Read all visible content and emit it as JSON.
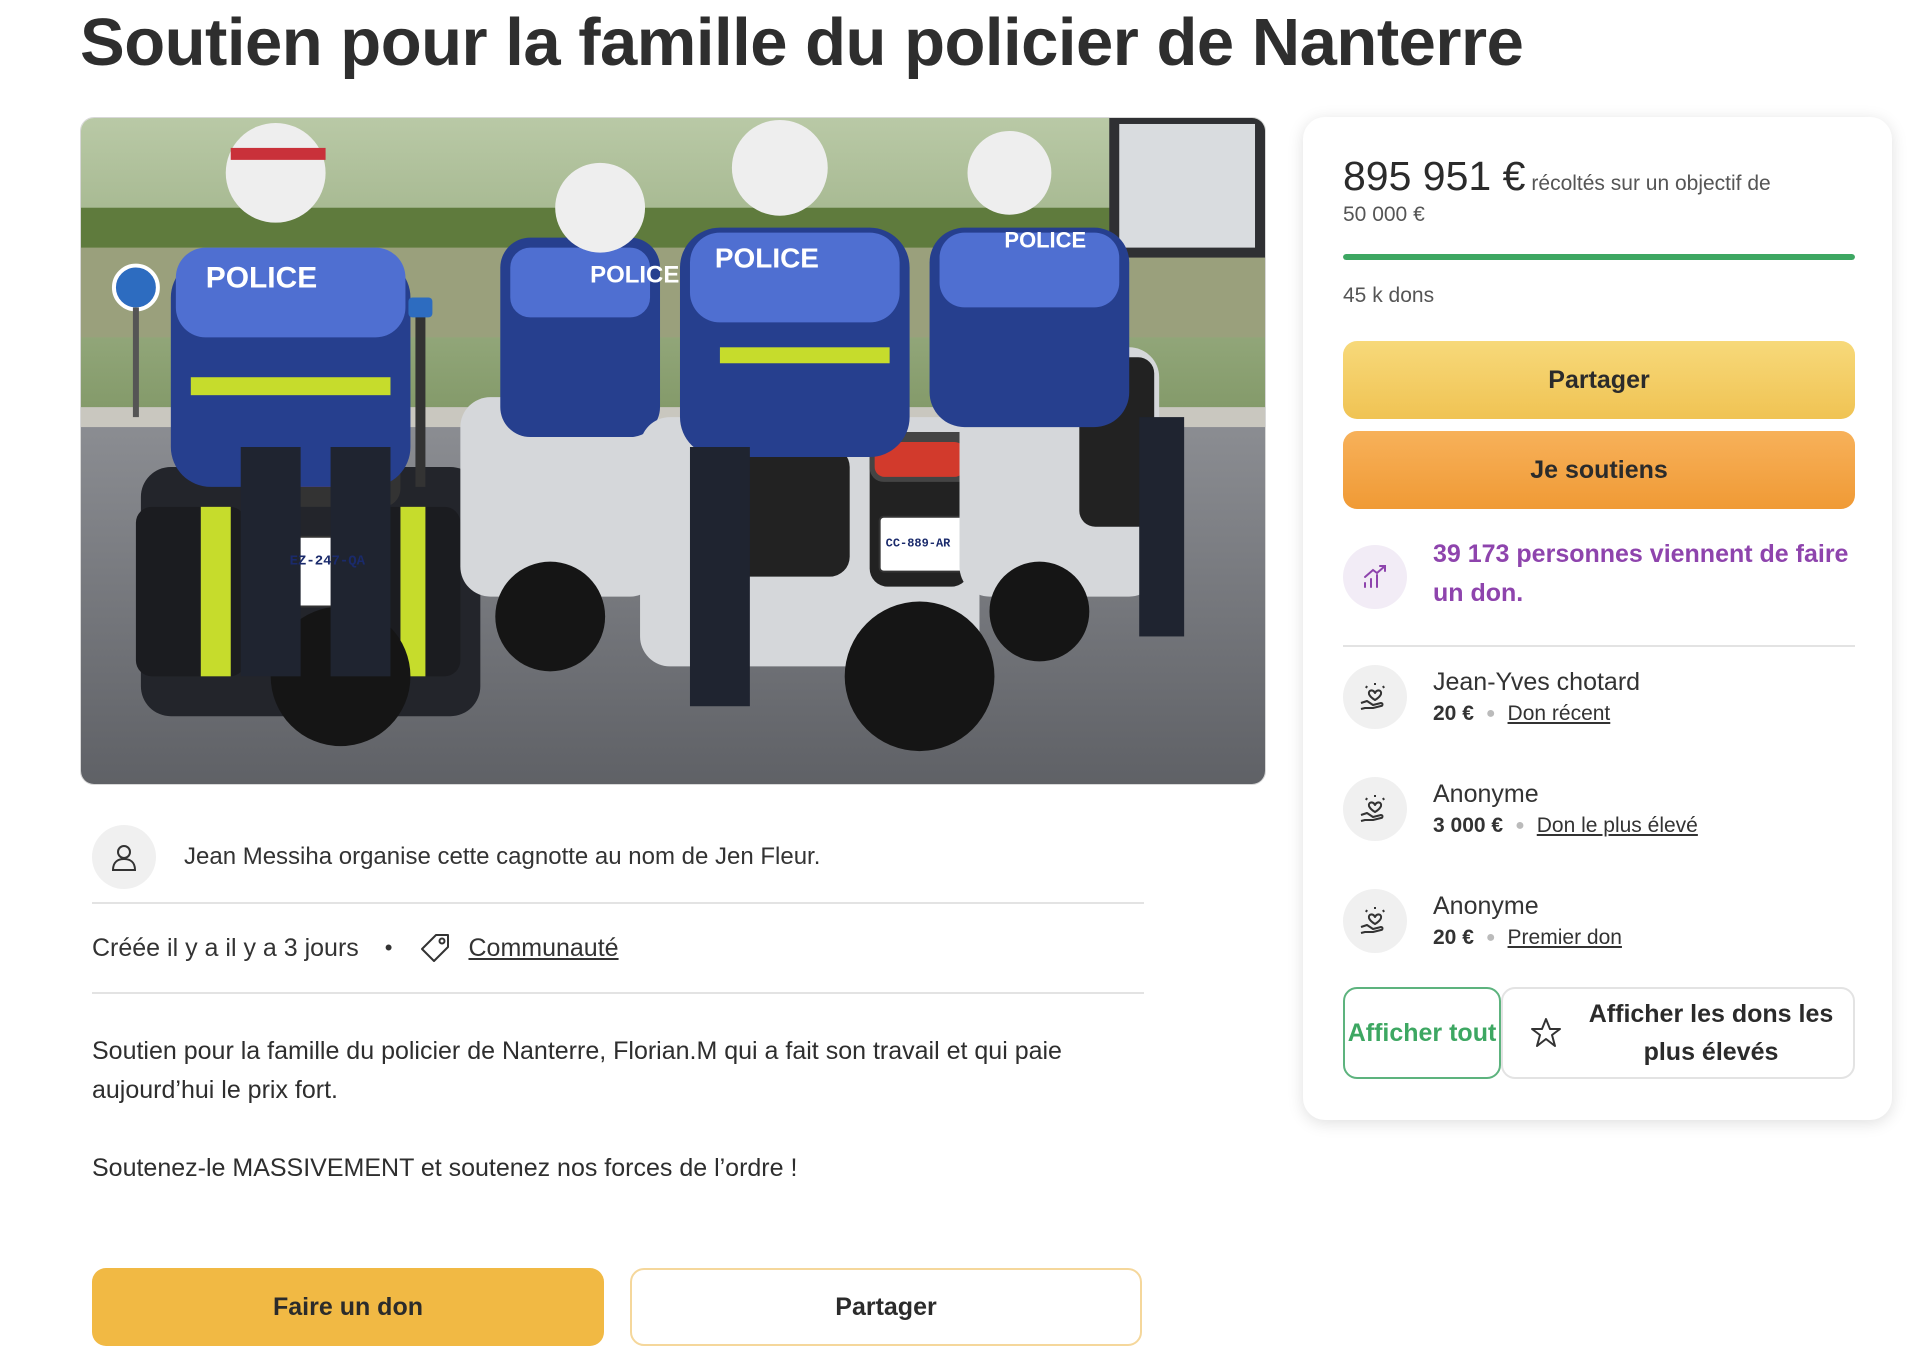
{
  "title": "Soutien pour la famille du policier de Nanterre",
  "hero": {
    "icon": "police-motorcycles-photo",
    "sign_texts": [
      "POLICE",
      "POLICE",
      "POLICE",
      "POLICE"
    ],
    "plates": [
      "EZ-247-QA",
      "CC-889-AR"
    ]
  },
  "organizer": {
    "icon": "user-icon",
    "text": "Jean Messiha organise cette cagnotte au nom de Jen Fleur."
  },
  "meta": {
    "created": "Créée il y a il y a 3 jours",
    "separator": "•",
    "tag_icon": "tag-icon",
    "category": "Communauté"
  },
  "description": {
    "paragraph1": "Soutien pour la famille du policier de Nanterre, Florian.M qui a fait son travail et qui paie aujourd’hui le prix fort.",
    "paragraph2": "Soutenez-le MASSIVEMENT et soutenez nos forces de l’ordre !"
  },
  "bottom_buttons": {
    "donate": "Faire un don",
    "share": "Partager"
  },
  "card": {
    "amount_raised": "895 951 €",
    "amount_text": "récoltés sur un objectif de",
    "goal": "50 000 €",
    "progress_fraction": 1.0,
    "donations_count": "45 k dons",
    "share_label": "Partager",
    "support_label": "Je soutiens",
    "trend_icon": "trending-up-icon",
    "trend_text": "39 173 personnes viennent de faire un don.",
    "donors": [
      {
        "name": "Jean-Yves chotard",
        "amount": "20 €",
        "label": "Don récent",
        "icon": "heart-hand-icon"
      },
      {
        "name": "Anonyme",
        "amount": "3 000 €",
        "label": "Don le plus élevé",
        "icon": "heart-hand-icon"
      },
      {
        "name": "Anonyme",
        "amount": "20 €",
        "label": "Premier don",
        "icon": "heart-hand-icon"
      }
    ],
    "show_all": "Afficher tout",
    "show_top_icon": "star-icon",
    "show_top": "Afficher les dons les plus élevés"
  },
  "colors": {
    "progress_green": "#3da762",
    "trend_purple": "#8e44ad",
    "donate_yellow": "#f1b944",
    "support_orange": "#f09a35"
  }
}
